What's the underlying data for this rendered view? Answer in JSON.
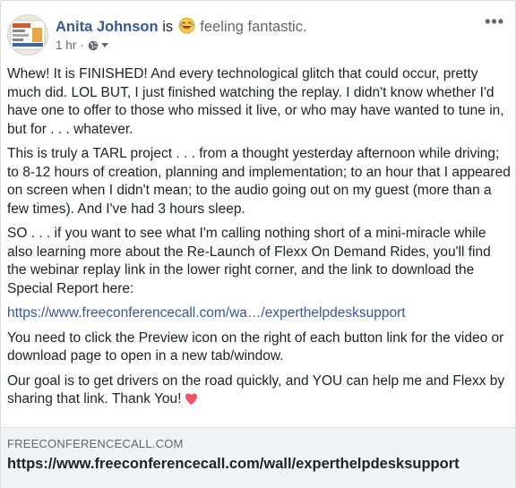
{
  "post": {
    "author": "Anita Johnson",
    "is_word": "is",
    "feeling": "feeling fantastic.",
    "time": "1 hr",
    "separator": "·",
    "privacy_icon": "globe-icon",
    "more_label": "•••",
    "paragraphs": [
      "Whew! It is FINISHED! And every technological glitch that could occur, pretty much did. LOL BUT, I just finished watching the replay. I didn't know whether I'd have one to offer to those who missed it live, or who may have wanted to tune in, but for . . . whatever.",
      "This is truly a TARL project . . . from a thought yesterday afternoon while driving; to 8-12 hours of creation, planning and implementation; to an hour that I appeared on screen when I didn't mean; to the audio going out on my guest (more than a few times). And I've had 3 hours sleep.",
      "SO . . . if you want to see what I'm calling nothing short of a mini-miracle while also learning more about the Re-Launch of Flexx On Demand Rides, you'll find the webinar replay link in the lower right corner, and the link to download the Special Report here:"
    ],
    "link_text": "https://www.freeconferencecall.com/wa…/experthelpdesksupport",
    "paragraph_after_link": "You need to click the Preview icon on the right of each button link for the video or download page to open in a new tab/window.",
    "closing": "Our goal is to get drivers on the road quickly, and YOU can help me and Flexx by sharing that link. Thank You!",
    "closing_icon": "heart-icon"
  },
  "link_preview": {
    "domain": "FREECONFERENCECALL.COM",
    "title": "https://www.freeconferencecall.com/wall/experthelpdesksupport"
  },
  "colors": {
    "author": "#385898",
    "link": "#385898",
    "heart": "#f25268",
    "preview_bg": "#f2f3f5"
  }
}
